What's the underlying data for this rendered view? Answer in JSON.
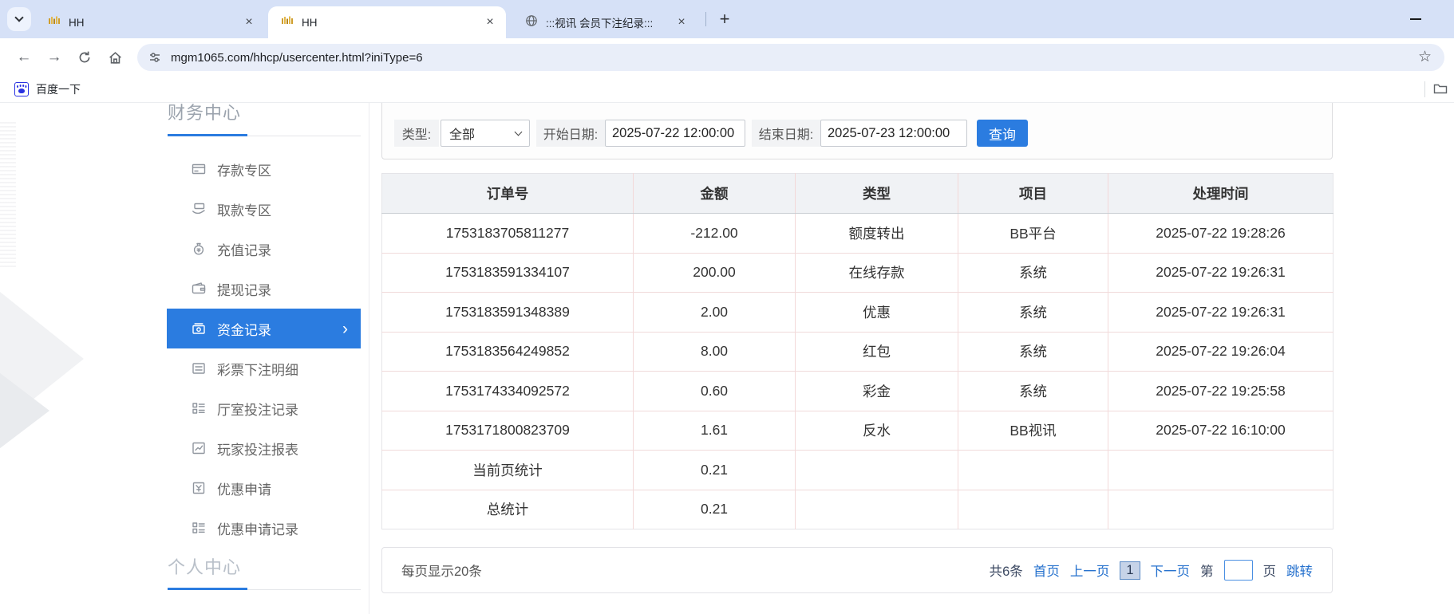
{
  "browser": {
    "tab_search_tooltip": "tab-search",
    "tabs": [
      {
        "title": "HH",
        "favicon": "gold-waveform-favicon",
        "active": false
      },
      {
        "title": "HH",
        "favicon": "gold-waveform-favicon",
        "active": true
      },
      {
        "title": ":::视讯 会员下注纪录:::",
        "favicon": "globe-favicon",
        "active": false
      }
    ],
    "new_tab_label": "+",
    "url": "mgm1065.com/hhcp/usercenter.html?iniType=6",
    "bookmarks_bar": {
      "items": [
        {
          "label": "百度一下"
        }
      ]
    }
  },
  "sidebar": {
    "section_top": {
      "label": "财务中心"
    },
    "items": [
      {
        "label": "存款专区",
        "icon": "deposit-card-icon",
        "active": false
      },
      {
        "label": "取款专区",
        "icon": "withdraw-hand-icon",
        "active": false
      },
      {
        "label": "充值记录",
        "icon": "moneybag-icon",
        "active": false
      },
      {
        "label": "提现记录",
        "icon": "wallet-icon",
        "active": false
      },
      {
        "label": "资金记录",
        "icon": "funds-icon",
        "active": true,
        "chevron": "›"
      },
      {
        "label": "彩票下注明细",
        "icon": "list-icon",
        "active": false
      },
      {
        "label": "厅室投注记录",
        "icon": "grid-list-icon",
        "active": false
      },
      {
        "label": "玩家投注报表",
        "icon": "report-chart-icon",
        "active": false
      },
      {
        "label": "优惠申请",
        "icon": "promo-icon",
        "active": false
      },
      {
        "label": "优惠申请记录",
        "icon": "grid-list-icon",
        "active": false
      }
    ],
    "section_bottom": {
      "label": "个人中心"
    }
  },
  "filters": {
    "type_label": "类型:",
    "type_value": "全部",
    "start_label": "开始日期:",
    "start_value": "2025-07-22 12:00:00",
    "end_label": "结束日期:",
    "end_value": "2025-07-23 12:00:00",
    "search_button": "查询"
  },
  "table": {
    "columns": [
      "订单号",
      "金额",
      "类型",
      "项目",
      "处理时间"
    ],
    "rows": [
      [
        "1753183705811277",
        "-212.00",
        "额度转出",
        "BB平台",
        "2025-07-22 19:28:26"
      ],
      [
        "1753183591334107",
        "200.00",
        "在线存款",
        "系统",
        "2025-07-22 19:26:31"
      ],
      [
        "1753183591348389",
        "2.00",
        "优惠",
        "系统",
        "2025-07-22 19:26:31"
      ],
      [
        "1753183564249852",
        "8.00",
        "红包",
        "系统",
        "2025-07-22 19:26:04"
      ],
      [
        "1753174334092572",
        "0.60",
        "彩金",
        "系统",
        "2025-07-22 19:25:58"
      ],
      [
        "1753171800823709",
        "1.61",
        "反水",
        "BB视讯",
        "2025-07-22 16:10:00"
      ],
      [
        "当前页统计",
        "0.21",
        "",
        "",
        ""
      ],
      [
        "总统计",
        "0.21",
        "",
        "",
        ""
      ]
    ]
  },
  "pagination": {
    "page_size_text": "每页显示20条",
    "total_text": "共6条",
    "first_label": "首页",
    "prev_label": "上一页",
    "current_page": "1",
    "next_label": "下一页",
    "jump_prefix": "第",
    "jump_value": "",
    "jump_suffix": "页",
    "jump_button": "跳转"
  },
  "colors": {
    "accent_blue": "#2b7ce0",
    "link_blue": "#2470cd",
    "tabstrip_bg": "#d6e1f7",
    "table_header_bg": "#f0f2f5",
    "cell_border_pink": "#f3dada"
  }
}
